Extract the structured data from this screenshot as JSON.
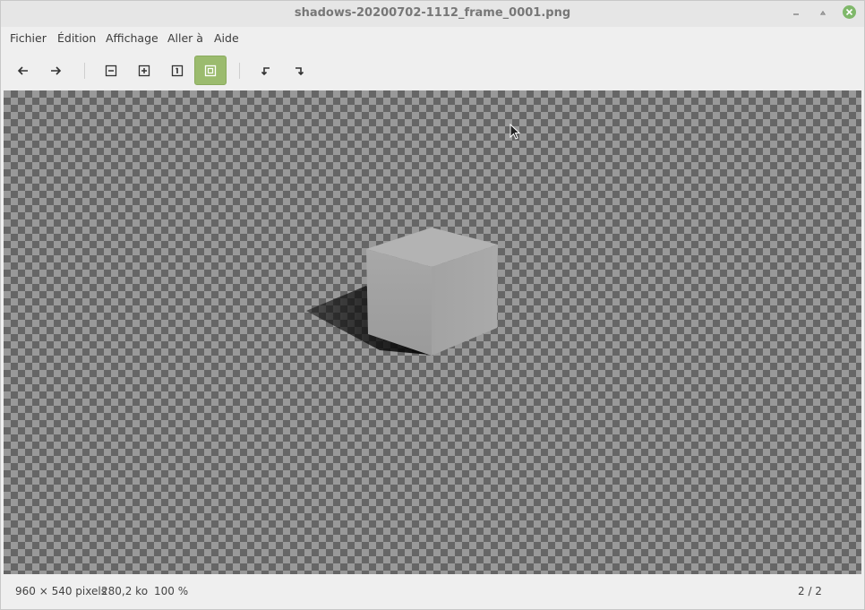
{
  "window": {
    "title": "shadows-20200702-1112_frame_0001.png"
  },
  "menu": {
    "items": [
      "Fichier",
      "Édition",
      "Affichage",
      "Aller à",
      "Aide"
    ]
  },
  "toolbar": {
    "buttons": [
      {
        "icon": "arrow-left-icon"
      },
      {
        "icon": "arrow-right-icon"
      },
      {
        "icon": "zoom-out-icon"
      },
      {
        "icon": "zoom-in-icon"
      },
      {
        "icon": "zoom-normal-icon"
      },
      {
        "icon": "zoom-fit-icon",
        "active": true
      },
      {
        "icon": "rotate-left-icon"
      },
      {
        "icon": "rotate-right-icon"
      }
    ],
    "active_color": "#9bbb6e"
  },
  "status": {
    "dimensions": "960 × 540 pixels",
    "size": "280,2 ko",
    "zoom": "100 %",
    "position": "2 / 2"
  },
  "colors": {
    "close_button": "#7fb86a",
    "checker_dark": "#666666",
    "checker_light": "#999999"
  }
}
